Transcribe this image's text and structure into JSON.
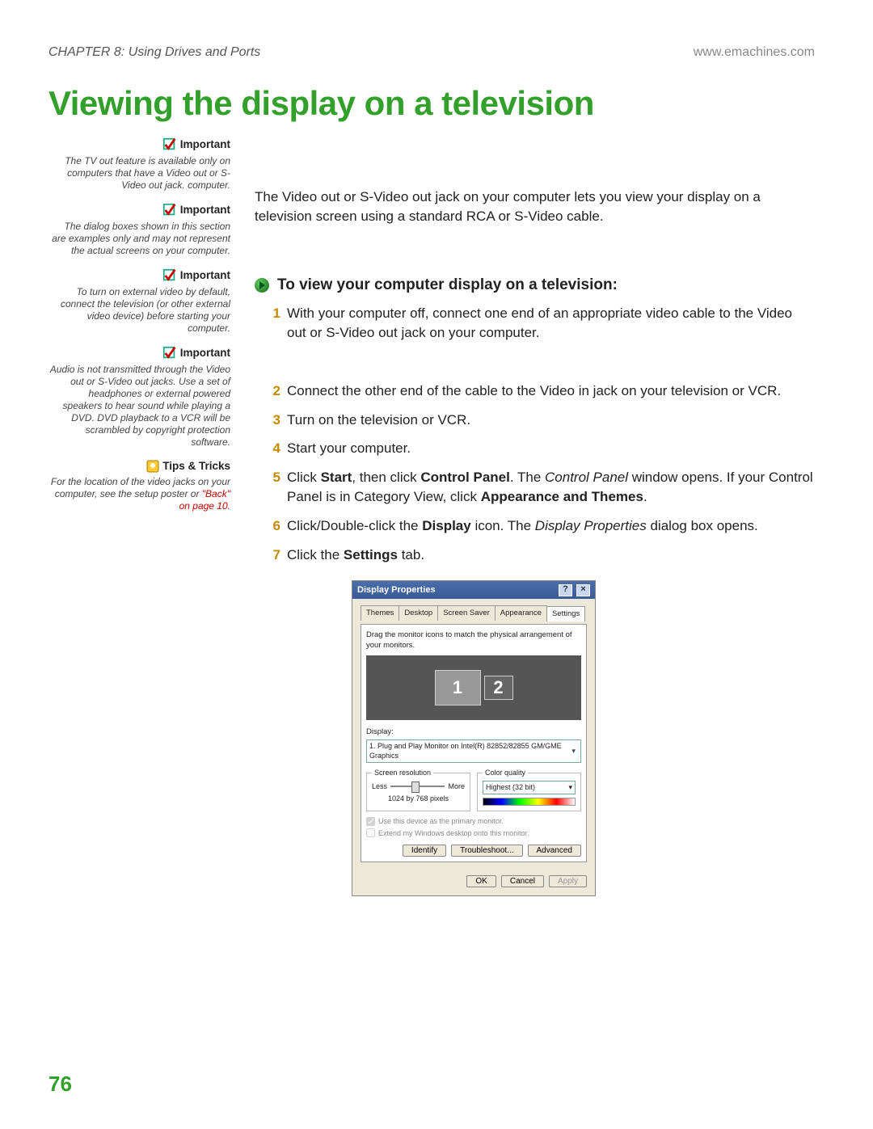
{
  "header": {
    "chapter": "CHAPTER 8: Using Drives and Ports",
    "url": "www.emachines.com"
  },
  "title": "Viewing the display on a television",
  "sidebar": {
    "important_label": "Important",
    "tips_label": "Tips & Tricks",
    "notes": [
      "The TV out feature is available only on computers that have a Video out or S-Video out jack. computer.",
      "The dialog boxes shown in this section are examples only and may not represent the actual screens on your computer.",
      "To turn on external video by default, connect the television (or other external video device) before starting your computer.",
      "Audio is not transmitted through the Video out or S-Video out jacks. Use a set of headphones or external powered speakers to hear sound while playing a DVD. DVD playback to a VCR will be scrambled by copyright protection software."
    ],
    "tip_text": "For the location of the video jacks on your computer, see the setup poster or ",
    "tip_link": "\"Back\" on page 10",
    "tip_after": "."
  },
  "intro": "The Video out or S-Video out jack on your computer lets you view your display on a television screen using a standard RCA or S-Video cable.",
  "task_title": "To view your computer display on a television:",
  "steps": [
    {
      "n": "1",
      "text": "With your computer off, connect one end of an appropriate video cable to the Video out or S-Video out jack on your computer."
    },
    {
      "n": "2",
      "text": "Connect the other end of the cable to the Video in jack on your television or VCR."
    },
    {
      "n": "3",
      "text": "Turn on the television or VCR."
    },
    {
      "n": "4",
      "text": "Start your computer."
    },
    {
      "n": "5",
      "html": "Click <b>Start</b>, then click <b>Control Panel</b>. The <i>Control Panel</i> window opens. If your Control Panel is in Category View, click <b>Appearance and Themes</b>."
    },
    {
      "n": "6",
      "html": "Click/Double-click the <b>Display</b> icon. The <i>Display Properties</i> dialog box opens."
    },
    {
      "n": "7",
      "html": "Click the <b>Settings</b> tab."
    }
  ],
  "dialog": {
    "title": "Display Properties",
    "tabs": [
      "Themes",
      "Desktop",
      "Screen Saver",
      "Appearance",
      "Settings"
    ],
    "active_tab": "Settings",
    "instruction": "Drag the monitor icons to match the physical arrangement of your monitors.",
    "monitors": [
      "1",
      "2"
    ],
    "display_label": "Display:",
    "display_value": "1. Plug and Play Monitor on Intel(R) 82852/82855 GM/GME Graphics",
    "resolution_legend": "Screen resolution",
    "res_less": "Less",
    "res_more": "More",
    "resolution_value": "1024 by 768 pixels",
    "color_legend": "Color quality",
    "color_value": "Highest (32 bit)",
    "chk1": "Use this device as the primary monitor.",
    "chk2": "Extend my Windows desktop onto this monitor.",
    "mid_buttons": [
      "Identify",
      "Troubleshoot...",
      "Advanced"
    ],
    "dlg_buttons": [
      "OK",
      "Cancel",
      "Apply"
    ]
  },
  "page_number": "76"
}
